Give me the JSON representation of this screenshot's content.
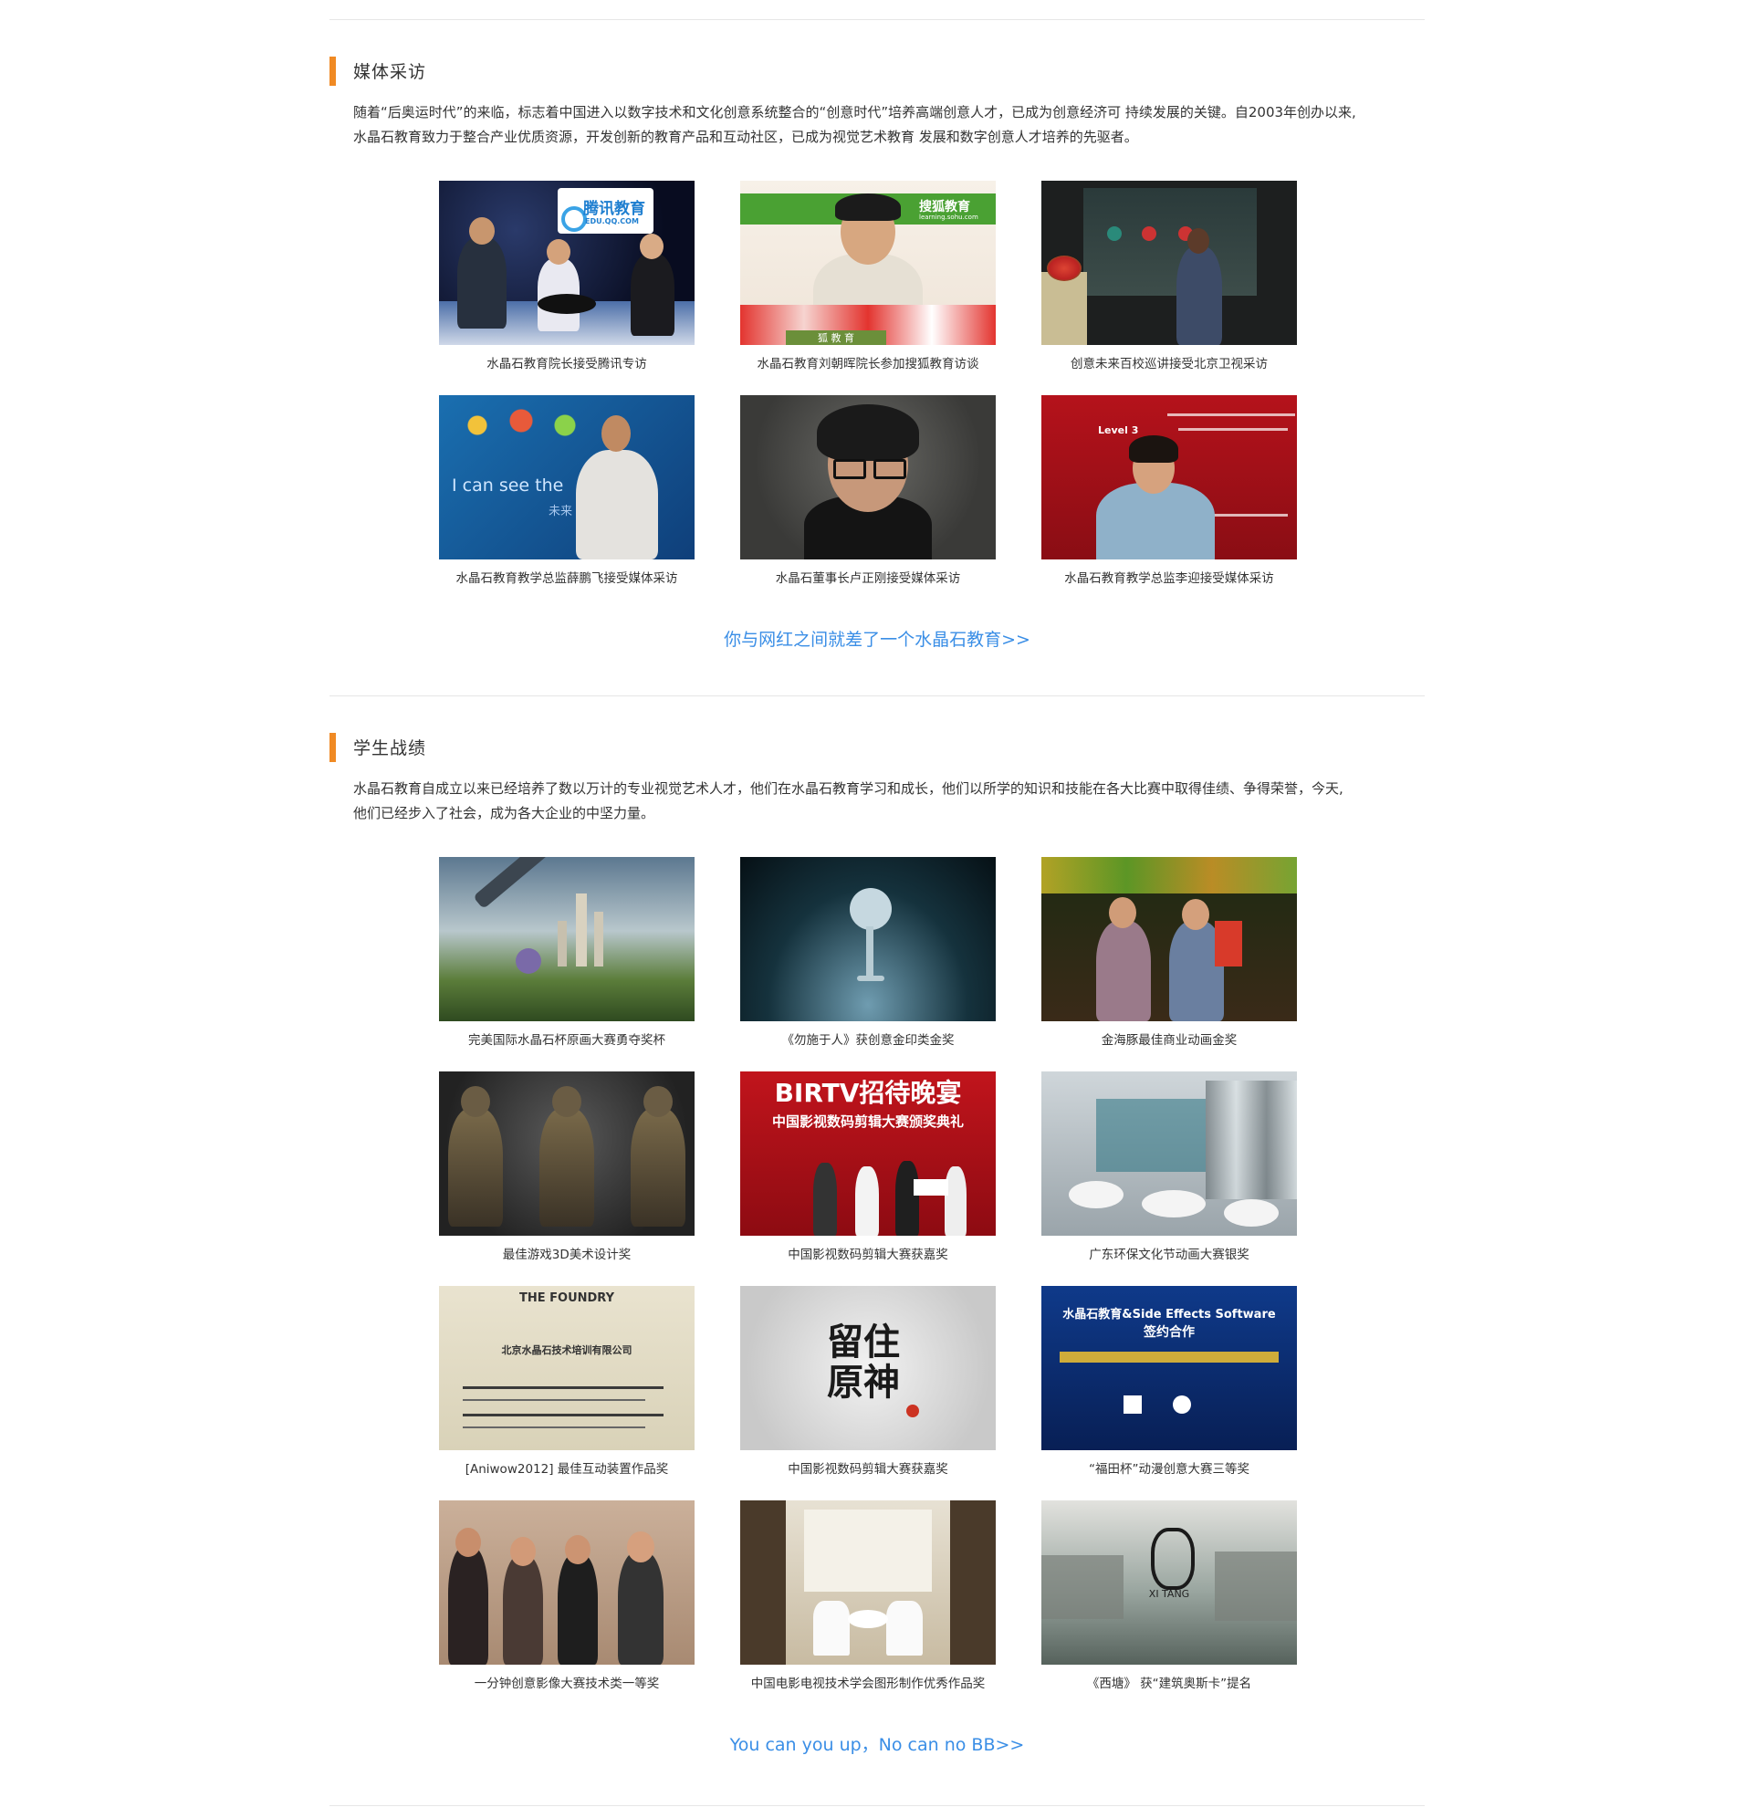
{
  "media": {
    "title": "媒体采访",
    "intro_line1": "随着“后奥运时代”的来临，标志着中国进入以数字技术和文化创意系统整合的“创意时代”培养高端创意人才，已成为创意经济可 持续发展的关键。自2003年创办以来,",
    "intro_line2": "水晶石教育致力于整合产业优质资源，开发创新的教育产品和互动社区，已成为视觉艺术教育 发展和数字创意人才培养的先驱者。",
    "items": [
      {
        "caption": "水晶石教育院长接受腾讯专访",
        "sign": "腾讯教育",
        "sign_sub": "EDU.QQ.COM"
      },
      {
        "caption": "水晶石教育刘朝晖院长参加搜狐教育访谈",
        "sign": "搜狐教育",
        "sign_sub": "learning.sohu.com"
      },
      {
        "caption": "创意未来百校巡讲接受北京卫视采访"
      },
      {
        "caption": "水晶石教育教学总监薛鹏飞接受媒体采访",
        "sign": "I can see the",
        "sign_sub": "未来"
      },
      {
        "caption": "水晶石董事长卢正刚接受媒体采访"
      },
      {
        "caption": "水晶石教育教学总监李迎接受媒体采访",
        "sign": "Level 3"
      }
    ],
    "more_link": "你与网红之间就差了一个水晶石教育>>"
  },
  "awards": {
    "title": "学生战绩",
    "intro_line1": "水晶石教育自成立以来已经培养了数以万计的专业视觉艺术人才，他们在水晶石教育学习和成长，他们以所学的知识和技能在各大比赛中取得佳绩、争得荣誉，今天,",
    "intro_line2": "他们已经步入了社会，成为各大企业的中坚力量。",
    "items": [
      {
        "caption": "完美国际水晶石杯原画大赛勇夺奖杯"
      },
      {
        "caption": "《勿施于人》获创意金印类金奖"
      },
      {
        "caption": "金海豚最佳商业动画金奖"
      },
      {
        "caption": "最佳游戏3D美术设计奖"
      },
      {
        "caption": "中国影视数码剪辑大赛获嘉奖",
        "sign": "BIRTV招待晚宴",
        "sign_sub": "中国影视数码剪辑大赛颁奖典礼"
      },
      {
        "caption": "广东环保文化节动画大赛银奖"
      },
      {
        "caption": "[Aniwow2012] 最佳互动装置作品奖",
        "sign": "THE FOUNDRY",
        "sign_sub": "北京水晶石技术培训有限公司"
      },
      {
        "caption": "中国影视数码剪辑大赛获嘉奖",
        "sign": "留住原神"
      },
      {
        "caption": "“福田杯”动漫创意大赛三等奖",
        "sign": "水晶石教育&Side Effects Software",
        "sign_sub": "签约合作"
      },
      {
        "caption": "一分钟创意影像大赛技术类一等奖"
      },
      {
        "caption": "中国电影电视技术学会图形制作优秀作品奖"
      },
      {
        "caption": "《西塘》 获“建筑奥斯卡”提名",
        "sign": "XI TANG"
      }
    ],
    "more_link": "You can you up，No can no BB>>"
  }
}
